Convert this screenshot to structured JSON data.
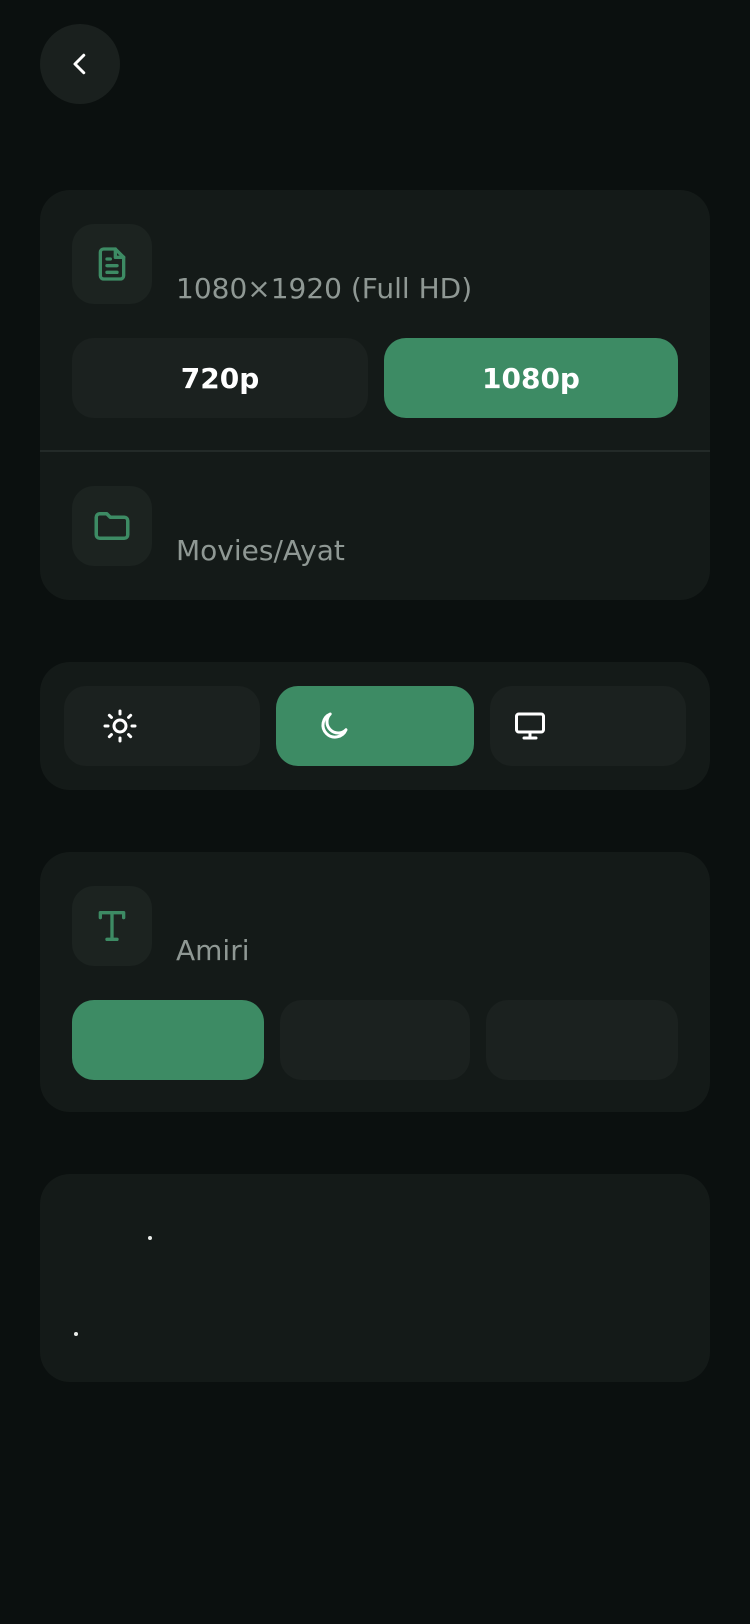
{
  "nav": {
    "back_icon": "chevron-left-icon"
  },
  "resolution": {
    "icon": "file-text-icon",
    "value": "1080×1920 (Full HD)",
    "options": [
      {
        "label": "720p",
        "selected": false
      },
      {
        "label": "1080p",
        "selected": true
      }
    ]
  },
  "save_location": {
    "icon": "folder-icon",
    "value": "Movies/Ayat"
  },
  "theme": {
    "options": [
      {
        "icon": "sun-icon",
        "selected": false
      },
      {
        "icon": "moon-icon",
        "selected": true
      },
      {
        "icon": "monitor-icon",
        "selected": false
      }
    ]
  },
  "font": {
    "icon": "type-icon",
    "value": "Amiri",
    "options": [
      {
        "selected": true
      },
      {
        "selected": false
      },
      {
        "selected": false
      }
    ]
  },
  "colors": {
    "accent": "#3d8b64",
    "background": "#0b100f",
    "card": "#141a18",
    "button": "#1b211f",
    "muted_text": "#8f9894"
  }
}
